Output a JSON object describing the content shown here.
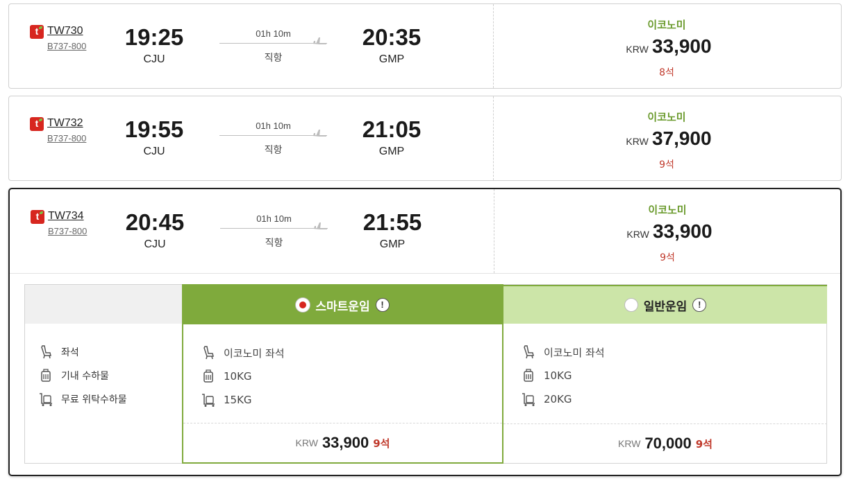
{
  "flights": [
    {
      "flight_no": "TW730",
      "aircraft": "B737-800",
      "dep_time": "19:25",
      "dep_airport": "CJU",
      "duration": "01h 10m",
      "route_type": "직항",
      "arr_time": "20:35",
      "arr_airport": "GMP",
      "fare_class": "이코노미",
      "currency": "KRW",
      "price": "33,900",
      "seats": "8석"
    },
    {
      "flight_no": "TW732",
      "aircraft": "B737-800",
      "dep_time": "19:55",
      "dep_airport": "CJU",
      "duration": "01h 10m",
      "route_type": "직항",
      "arr_time": "21:05",
      "arr_airport": "GMP",
      "fare_class": "이코노미",
      "currency": "KRW",
      "price": "37,900",
      "seats": "9석"
    },
    {
      "flight_no": "TW734",
      "aircraft": "B737-800",
      "dep_time": "20:45",
      "dep_airport": "CJU",
      "duration": "01h 10m",
      "route_type": "직항",
      "arr_time": "21:55",
      "arr_airport": "GMP",
      "fare_class": "이코노미",
      "currency": "KRW",
      "price": "33,900",
      "seats": "9석"
    }
  ],
  "detail": {
    "labels": {
      "seat": "좌석",
      "carry_on": "기내 수하물",
      "checked": "무료 위탁수하물"
    },
    "smart": {
      "title": "스마트운임",
      "selected": true,
      "seat": "이코노미 좌석",
      "carry_on": "10KG",
      "checked": "15KG",
      "currency": "KRW",
      "price": "33,900",
      "seats": "9석"
    },
    "normal": {
      "title": "일반운임",
      "selected": false,
      "seat": "이코노미 좌석",
      "carry_on": "10KG",
      "checked": "20KG",
      "currency": "KRW",
      "price": "70,000",
      "seats": "9석"
    },
    "info_icon": "!"
  },
  "colors": {
    "accent_green": "#7faa3c",
    "light_green": "#cce5a8",
    "seat_red": "#c0392b",
    "brand_red": "#d7261f"
  },
  "icons": [
    "tway-logo-icon",
    "airplane-icon",
    "seat-icon",
    "carry-on-icon",
    "checked-baggage-icon",
    "info-icon",
    "radio-icon"
  ]
}
